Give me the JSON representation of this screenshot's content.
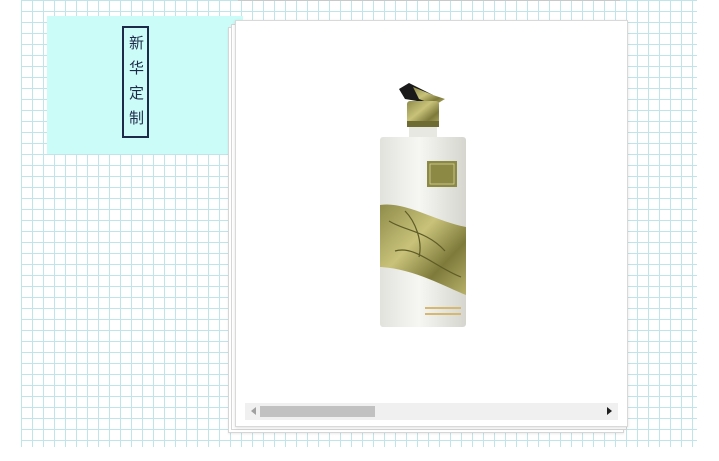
{
  "label": {
    "text": "新华定制"
  },
  "colors": {
    "grid_line": "#bfe4ea",
    "label_panel": "#ccfcf8",
    "label_border": "#1e2a4a",
    "scrollbar_track": "#f0f0f0",
    "scrollbar_thumb": "#c1c1c1"
  },
  "viewer": {
    "image": "baijiu-bottle-product-photo",
    "scroll_position": 0
  }
}
